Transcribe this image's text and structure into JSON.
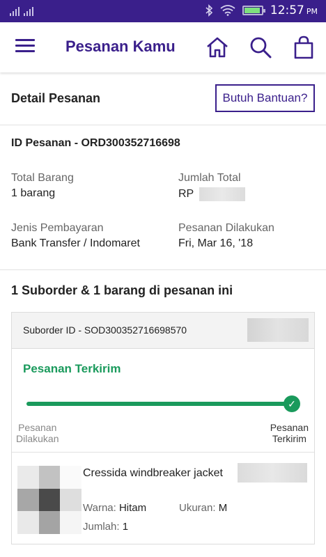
{
  "status_bar": {
    "time": "12:57",
    "ampm": "PM"
  },
  "app_bar": {
    "title": "Pesanan Kamu"
  },
  "detail": {
    "title": "Detail Pesanan",
    "help_button": "Butuh Bantuan?"
  },
  "order": {
    "id_text": "ID Pesanan - ORD300352716698",
    "total_items_label": "Total Barang",
    "total_items_value": "1 barang",
    "total_amount_label": "Jumlah Total",
    "total_amount_currency": "RP",
    "payment_label": "Jenis Pembayaran",
    "payment_value": "Bank Transfer / Indomaret",
    "placed_label": "Pesanan Dilakukan",
    "placed_value": "Fri, Mar 16, '18"
  },
  "summary": "1 Suborder & 1 barang di pesanan ini",
  "suborder": {
    "id_text": "Suborder ID - SOD300352716698570",
    "status": "Pesanan Terkirim",
    "progress": 1.0,
    "step_start_line1": "Pesanan",
    "step_start_line2": "Dilakukan",
    "step_end_line1": "Pesanan",
    "step_end_line2": "Terkirim"
  },
  "product": {
    "name": "Cressida windbreaker jacket",
    "color_label": "Warna:",
    "color_value": "Hitam",
    "size_label": "Ukuran:",
    "size_value": "M",
    "qty_label": "Jumlah:",
    "qty_value": "1"
  },
  "colors": {
    "brand": "#3a1f8b",
    "success": "#1a9a5c"
  }
}
